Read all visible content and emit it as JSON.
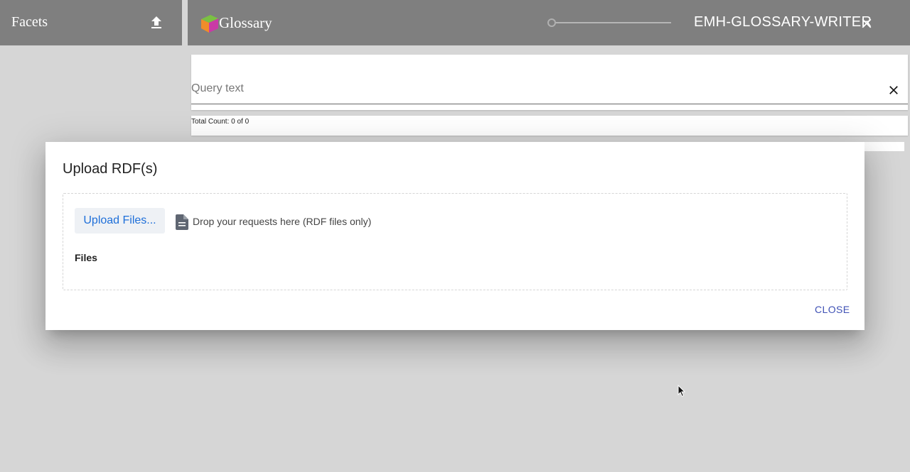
{
  "facets": {
    "title": "Facets",
    "upload_icon": "upload-icon"
  },
  "header": {
    "app_title": "Glossary",
    "logo_icon": "cube-logo",
    "user": "EMH-GLOSSARY-WRITER",
    "close_icon": "close-icon"
  },
  "search": {
    "placeholder": "Query text",
    "value": "",
    "clear_icon": "close-icon"
  },
  "results": {
    "total_count": "Total Count: 0 of 0"
  },
  "dialog": {
    "title": "Upload RDF(s)",
    "upload_button": "Upload Files...",
    "drop_text": "Drop your requests here (RDF files only)",
    "drop_icon": "document-icon",
    "files_label": "Files",
    "close_button": "CLOSE"
  },
  "colors": {
    "header_bg": "#7f7f7f",
    "page_bg": "#d6d6d6",
    "upload_button_text": "#1e6fd9",
    "close_button_text": "#3f51b5"
  }
}
